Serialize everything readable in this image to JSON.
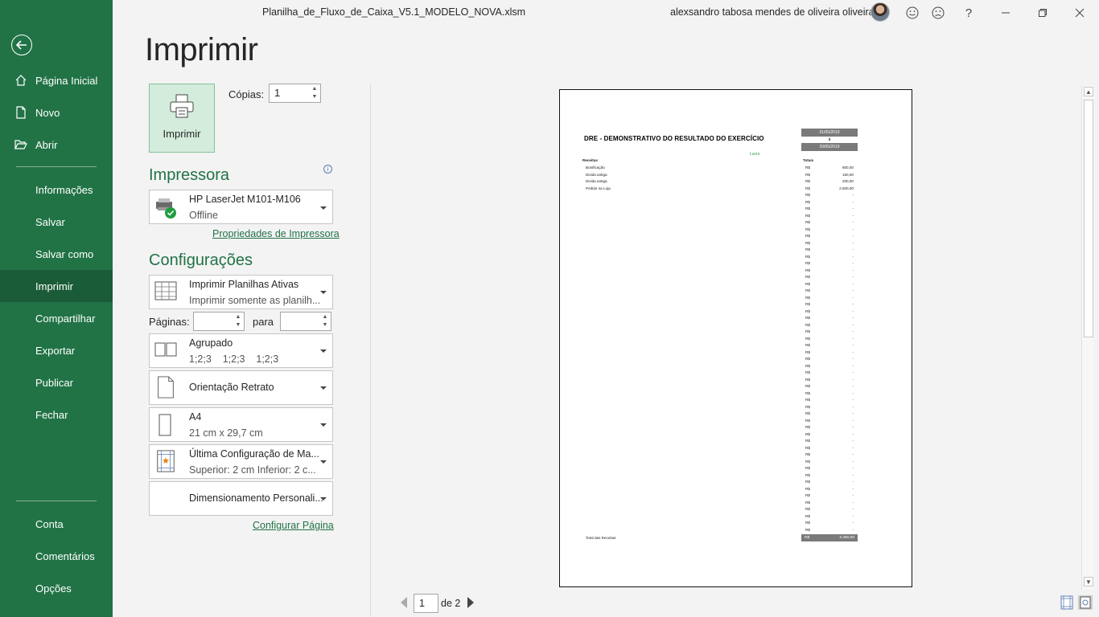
{
  "window": {
    "title": "Planilha_de_Fluxo_de_Caixa_V5.1_MODELO_NOVA.xlsm",
    "user_name": "alexsandro tabosa mendes de oliveira oliveira"
  },
  "sidebar": {
    "items": [
      {
        "label": "Página Inicial",
        "icon": "home-icon"
      },
      {
        "label": "Novo",
        "icon": "new-document-icon"
      },
      {
        "label": "Abrir",
        "icon": "folder-open-icon"
      },
      {
        "label": "Informações"
      },
      {
        "label": "Salvar"
      },
      {
        "label": "Salvar como"
      },
      {
        "label": "Imprimir",
        "active": true
      },
      {
        "label": "Compartilhar"
      },
      {
        "label": "Exportar"
      },
      {
        "label": "Publicar"
      },
      {
        "label": "Fechar"
      },
      {
        "label": "Conta"
      },
      {
        "label": "Comentários"
      },
      {
        "label": "Opções"
      }
    ]
  },
  "print": {
    "heading": "Imprimir",
    "print_button_label": "Imprimir",
    "copies_label": "Cópias:",
    "copies_value": "1",
    "printer_section": "Impressora",
    "printer_name": "HP LaserJet M101-M106",
    "printer_status": "Offline",
    "printer_properties_link": "Propriedades de Impressora",
    "settings_section": "Configurações",
    "what_to_print": {
      "line1": "Imprimir Planilhas Ativas",
      "line2": "Imprimir somente as planilh..."
    },
    "pages_label": "Páginas:",
    "pages_to_label": "para",
    "collation": {
      "line1": "Agrupado",
      "line2": "1;2;3    1;2;3    1;2;3"
    },
    "orientation": {
      "line1": "Orientação Retrato"
    },
    "paper_size": {
      "line1": "A4",
      "line2": "21 cm x 29,7 cm"
    },
    "margins": {
      "line1": "Última Configuração de Ma...",
      "line2": "Superior: 2 cm Inferior: 2 c..."
    },
    "scaling": {
      "line1": "Dimensionamento Personali..."
    },
    "page_setup_link": "Configurar Página"
  },
  "preview": {
    "current_page": "1",
    "total_pages_text": "de 2",
    "document": {
      "title": "DRE - DEMONSTRATIVO DO RESULTADO DO EXERCÍCIO",
      "date_start": "01/05/2019",
      "date_sep": "à",
      "date_end": "20/06/2019",
      "lucro_label": "Lucro",
      "receitas_label": "Receitas",
      "totais_label": "Totais",
      "currency": "R$",
      "rows": [
        {
          "label": "Bonificação",
          "value": "600,00"
        },
        {
          "label": "Divida antiga",
          "value": "150,00"
        },
        {
          "label": "Divida antiga",
          "value": "200,00"
        },
        {
          "label": "Pedido na Loja",
          "value": "2.500,00"
        }
      ],
      "empty_value": "-",
      "total_label": "Total das Receitas",
      "total_value": "3.450,00"
    }
  },
  "colors": {
    "brand_green": "#217346",
    "active_nav": "#1a5c37",
    "print_button_bg": "#d3ecdc"
  }
}
